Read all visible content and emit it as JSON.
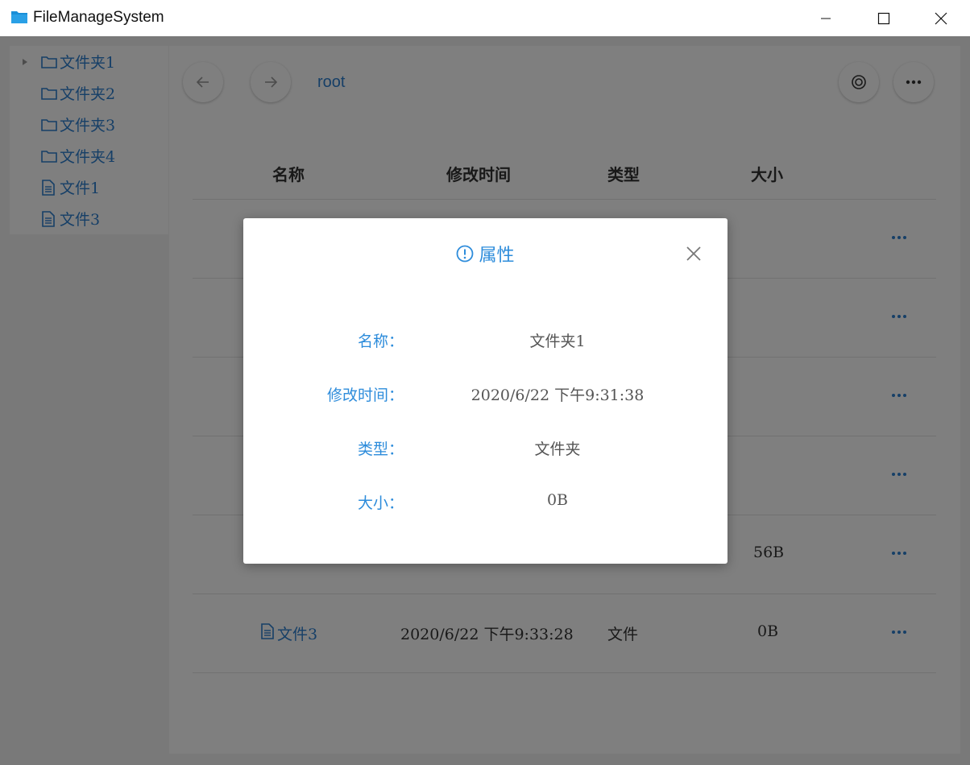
{
  "window": {
    "title": "FileManageSystem"
  },
  "sidebar": {
    "items": [
      {
        "label": "文件夹1",
        "icon": "folder-icon",
        "expandable": true
      },
      {
        "label": "文件夹2",
        "icon": "folder-icon"
      },
      {
        "label": "文件夹3",
        "icon": "folder-icon"
      },
      {
        "label": "文件夹4",
        "icon": "folder-icon"
      },
      {
        "label": "文件1",
        "icon": "file-icon"
      },
      {
        "label": "文件3",
        "icon": "file-icon"
      }
    ]
  },
  "toolbar": {
    "breadcrumb": "root"
  },
  "table": {
    "headers": {
      "name": "名称",
      "modified": "修改时间",
      "type": "类型",
      "size": "大小"
    },
    "rows": [
      {
        "name": "",
        "modified": "",
        "type": "",
        "size": ""
      },
      {
        "name": "",
        "modified": "",
        "type": "",
        "size": ""
      },
      {
        "name": "",
        "modified": "",
        "type": "",
        "size": ""
      },
      {
        "name": "",
        "modified": "",
        "type": "",
        "size": ""
      },
      {
        "name": "",
        "modified": "",
        "type": "",
        "size": "56B"
      },
      {
        "name": "文件3",
        "modified": "2020/6/22 下午9:33:28",
        "type": "文件",
        "size": "0B"
      }
    ]
  },
  "modal": {
    "title": "属性",
    "props": [
      {
        "label": "名称：",
        "value": "文件夹1"
      },
      {
        "label": "修改时间：",
        "value": "2020/6/22 下午9:31:38"
      },
      {
        "label": "类型：",
        "value": "文件夹"
      },
      {
        "label": "大小：",
        "value": "0B"
      }
    ]
  },
  "colors": {
    "accent": "#2d8cdb",
    "link": "#2d7fcf",
    "overlay": "rgba(0,0,0,0.5)"
  }
}
